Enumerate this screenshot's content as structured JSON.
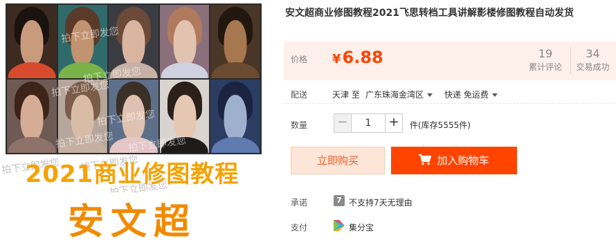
{
  "gallery": {
    "banner_title": "2021商业修图教程",
    "banner_name": "安文超",
    "watermark": "拍下立即发您"
  },
  "product": {
    "title": "安文超商业修图教程2021飞思转档工具讲解影楼修图教程自动发货"
  },
  "price": {
    "label": "价格",
    "currency": "¥",
    "value": "6.88",
    "reviews_count": "19",
    "reviews_label": "累计评论",
    "sales_count": "34",
    "sales_label": "交易成功"
  },
  "shipping": {
    "label": "配送",
    "from": "天津 至",
    "to": "广东珠海金湾区",
    "method": "快递 免运费"
  },
  "quantity": {
    "label": "数量",
    "minus": "−",
    "value": "1",
    "plus": "+",
    "stock": "件(库存5555件)"
  },
  "actions": {
    "buy_now": "立即购买",
    "add_cart": "加入购物车"
  },
  "promise": {
    "label": "承诺",
    "icon_glyph": "7",
    "text": "不支持7天无理由"
  },
  "payment": {
    "label": "支付",
    "text": "集分宝"
  },
  "colors": {
    "accent": "#ff4400",
    "price_bg": "#fdf0ea",
    "banner_orange": "#f5a200"
  }
}
